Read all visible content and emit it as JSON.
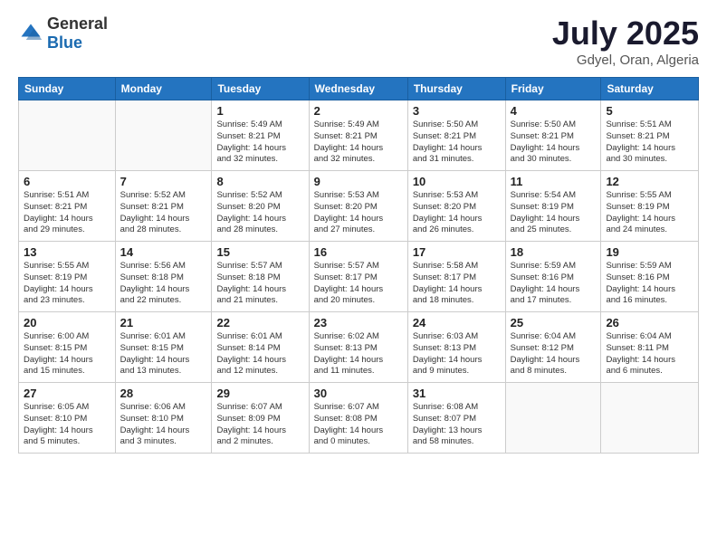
{
  "header": {
    "logo_general": "General",
    "logo_blue": "Blue",
    "title": "July 2025",
    "subtitle": "Gdyel, Oran, Algeria"
  },
  "columns": [
    "Sunday",
    "Monday",
    "Tuesday",
    "Wednesday",
    "Thursday",
    "Friday",
    "Saturday"
  ],
  "weeks": [
    [
      {
        "day": "",
        "info": ""
      },
      {
        "day": "",
        "info": ""
      },
      {
        "day": "1",
        "info": "Sunrise: 5:49 AM\nSunset: 8:21 PM\nDaylight: 14 hours\nand 32 minutes."
      },
      {
        "day": "2",
        "info": "Sunrise: 5:49 AM\nSunset: 8:21 PM\nDaylight: 14 hours\nand 32 minutes."
      },
      {
        "day": "3",
        "info": "Sunrise: 5:50 AM\nSunset: 8:21 PM\nDaylight: 14 hours\nand 31 minutes."
      },
      {
        "day": "4",
        "info": "Sunrise: 5:50 AM\nSunset: 8:21 PM\nDaylight: 14 hours\nand 30 minutes."
      },
      {
        "day": "5",
        "info": "Sunrise: 5:51 AM\nSunset: 8:21 PM\nDaylight: 14 hours\nand 30 minutes."
      }
    ],
    [
      {
        "day": "6",
        "info": "Sunrise: 5:51 AM\nSunset: 8:21 PM\nDaylight: 14 hours\nand 29 minutes."
      },
      {
        "day": "7",
        "info": "Sunrise: 5:52 AM\nSunset: 8:21 PM\nDaylight: 14 hours\nand 28 minutes."
      },
      {
        "day": "8",
        "info": "Sunrise: 5:52 AM\nSunset: 8:20 PM\nDaylight: 14 hours\nand 28 minutes."
      },
      {
        "day": "9",
        "info": "Sunrise: 5:53 AM\nSunset: 8:20 PM\nDaylight: 14 hours\nand 27 minutes."
      },
      {
        "day": "10",
        "info": "Sunrise: 5:53 AM\nSunset: 8:20 PM\nDaylight: 14 hours\nand 26 minutes."
      },
      {
        "day": "11",
        "info": "Sunrise: 5:54 AM\nSunset: 8:19 PM\nDaylight: 14 hours\nand 25 minutes."
      },
      {
        "day": "12",
        "info": "Sunrise: 5:55 AM\nSunset: 8:19 PM\nDaylight: 14 hours\nand 24 minutes."
      }
    ],
    [
      {
        "day": "13",
        "info": "Sunrise: 5:55 AM\nSunset: 8:19 PM\nDaylight: 14 hours\nand 23 minutes."
      },
      {
        "day": "14",
        "info": "Sunrise: 5:56 AM\nSunset: 8:18 PM\nDaylight: 14 hours\nand 22 minutes."
      },
      {
        "day": "15",
        "info": "Sunrise: 5:57 AM\nSunset: 8:18 PM\nDaylight: 14 hours\nand 21 minutes."
      },
      {
        "day": "16",
        "info": "Sunrise: 5:57 AM\nSunset: 8:17 PM\nDaylight: 14 hours\nand 20 minutes."
      },
      {
        "day": "17",
        "info": "Sunrise: 5:58 AM\nSunset: 8:17 PM\nDaylight: 14 hours\nand 18 minutes."
      },
      {
        "day": "18",
        "info": "Sunrise: 5:59 AM\nSunset: 8:16 PM\nDaylight: 14 hours\nand 17 minutes."
      },
      {
        "day": "19",
        "info": "Sunrise: 5:59 AM\nSunset: 8:16 PM\nDaylight: 14 hours\nand 16 minutes."
      }
    ],
    [
      {
        "day": "20",
        "info": "Sunrise: 6:00 AM\nSunset: 8:15 PM\nDaylight: 14 hours\nand 15 minutes."
      },
      {
        "day": "21",
        "info": "Sunrise: 6:01 AM\nSunset: 8:15 PM\nDaylight: 14 hours\nand 13 minutes."
      },
      {
        "day": "22",
        "info": "Sunrise: 6:01 AM\nSunset: 8:14 PM\nDaylight: 14 hours\nand 12 minutes."
      },
      {
        "day": "23",
        "info": "Sunrise: 6:02 AM\nSunset: 8:13 PM\nDaylight: 14 hours\nand 11 minutes."
      },
      {
        "day": "24",
        "info": "Sunrise: 6:03 AM\nSunset: 8:13 PM\nDaylight: 14 hours\nand 9 minutes."
      },
      {
        "day": "25",
        "info": "Sunrise: 6:04 AM\nSunset: 8:12 PM\nDaylight: 14 hours\nand 8 minutes."
      },
      {
        "day": "26",
        "info": "Sunrise: 6:04 AM\nSunset: 8:11 PM\nDaylight: 14 hours\nand 6 minutes."
      }
    ],
    [
      {
        "day": "27",
        "info": "Sunrise: 6:05 AM\nSunset: 8:10 PM\nDaylight: 14 hours\nand 5 minutes."
      },
      {
        "day": "28",
        "info": "Sunrise: 6:06 AM\nSunset: 8:10 PM\nDaylight: 14 hours\nand 3 minutes."
      },
      {
        "day": "29",
        "info": "Sunrise: 6:07 AM\nSunset: 8:09 PM\nDaylight: 14 hours\nand 2 minutes."
      },
      {
        "day": "30",
        "info": "Sunrise: 6:07 AM\nSunset: 8:08 PM\nDaylight: 14 hours\nand 0 minutes."
      },
      {
        "day": "31",
        "info": "Sunrise: 6:08 AM\nSunset: 8:07 PM\nDaylight: 13 hours\nand 58 minutes."
      },
      {
        "day": "",
        "info": ""
      },
      {
        "day": "",
        "info": ""
      }
    ]
  ]
}
